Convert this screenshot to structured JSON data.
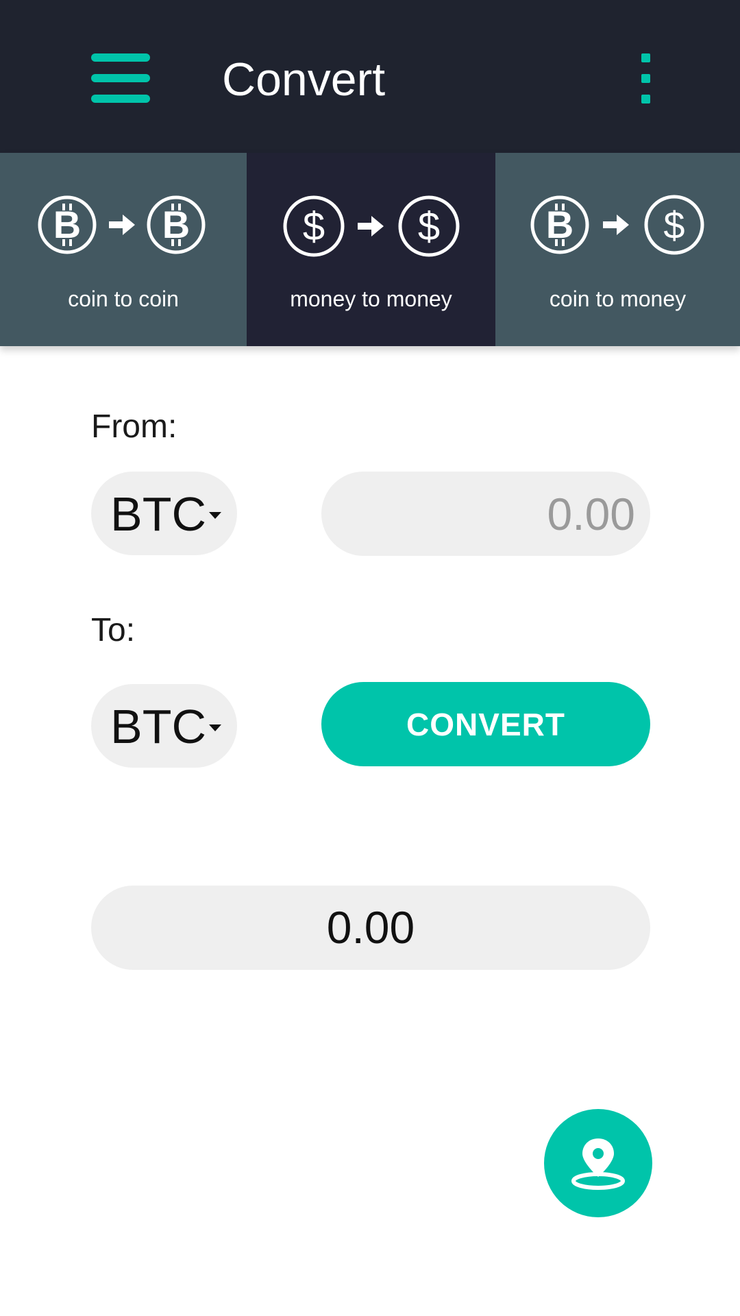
{
  "app_bar": {
    "title": "Convert",
    "menu_icon": "hamburger-menu-icon",
    "overflow_icon": "more-vertical-icon",
    "background": "#1f232f",
    "accent": "#00c4aa"
  },
  "tabs": [
    {
      "label": "coin to coin",
      "from_icon": "bitcoin-icon",
      "to_icon": "bitcoin-icon",
      "active": false
    },
    {
      "label": "money to money",
      "from_icon": "dollar-icon",
      "to_icon": "dollar-icon",
      "active": true
    },
    {
      "label": "coin to money",
      "from_icon": "bitcoin-icon",
      "to_icon": "dollar-icon",
      "active": false
    }
  ],
  "form": {
    "from_label": "From:",
    "from_currency": "BTC",
    "amount_placeholder": "0.00",
    "to_label": "To:",
    "to_currency": "BTC",
    "convert_label": "CONVERT",
    "result_value": "0.00"
  },
  "fab": {
    "icon": "map-location-pin-icon"
  },
  "colors": {
    "tab_inactive": "#435861",
    "tab_active": "#212234",
    "field_background": "#efefef",
    "accent": "#00c4aa"
  }
}
